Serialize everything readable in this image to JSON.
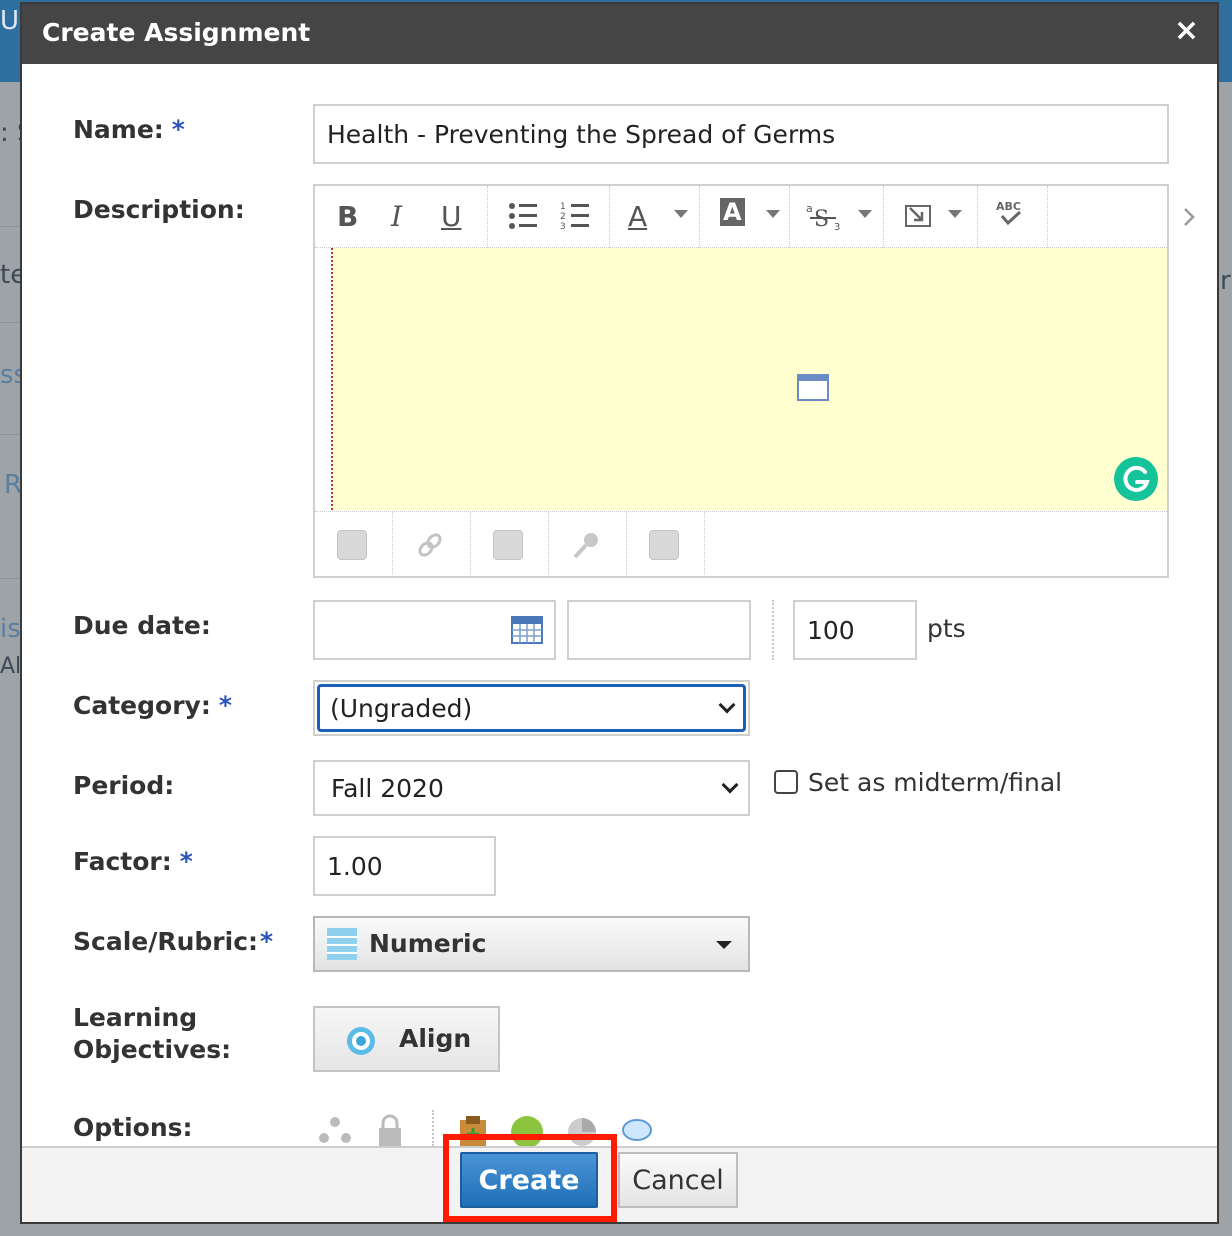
{
  "background": {
    "left_fragments": [
      "Ul",
      ": S",
      "te",
      "ss",
      "R",
      "is",
      "Al"
    ],
    "right_fragments": [
      "r"
    ]
  },
  "dialog": {
    "title": "Create Assignment",
    "close_glyph": "×"
  },
  "form": {
    "name": {
      "label": "Name:",
      "required_mark": "*",
      "value": "Health - Preventing the Spread of Germs"
    },
    "description": {
      "label": "Description:"
    },
    "due_date": {
      "label": "Due date:",
      "date_value": "",
      "time_value": "",
      "points_value": "100",
      "points_unit": "pts"
    },
    "category": {
      "label": "Category:",
      "required_mark": "*",
      "selected": "(Ungraded)"
    },
    "period": {
      "label": "Period:",
      "selected": "Fall 2020",
      "midterm_checkbox_label": "Set as midterm/final",
      "midterm_checked": false
    },
    "factor": {
      "label": "Factor:",
      "required_mark": "*",
      "value": "1.00"
    },
    "scale": {
      "label": "Scale/Rubric:",
      "required_mark": "*",
      "selected": "Numeric"
    },
    "objectives": {
      "label_line1": "Learning",
      "label_line2": "Objectives:",
      "button_label": "Align"
    },
    "options": {
      "label": "Options:"
    }
  },
  "editor": {
    "toolbar_top": [
      "bold-icon",
      "italic-icon",
      "underline-icon",
      "bullet-list-icon",
      "numbered-list-icon",
      "font-color-icon",
      "highlight-color-icon",
      "strikethrough-icon",
      "insert-icon",
      "spellcheck-icon"
    ],
    "toolbar_bottom": [
      "insert-image-icon",
      "insert-link-icon",
      "insert-file-icon",
      "record-audio-icon",
      "insert-table-icon"
    ],
    "glyphs": {
      "bold": "B",
      "italic": "I",
      "underline": "U",
      "font_color": "A",
      "highlight": "A",
      "spellcheck": "ABC"
    },
    "area_color": "#ffffd0"
  },
  "footer": {
    "create_label": "Create",
    "cancel_label": "Cancel"
  },
  "colors": {
    "titlebar": "#454545",
    "primary_button": "#2a7bc5",
    "highlight_box": "#ff1a00",
    "required": "#2b52b8",
    "grammarly": "#15c39a"
  }
}
